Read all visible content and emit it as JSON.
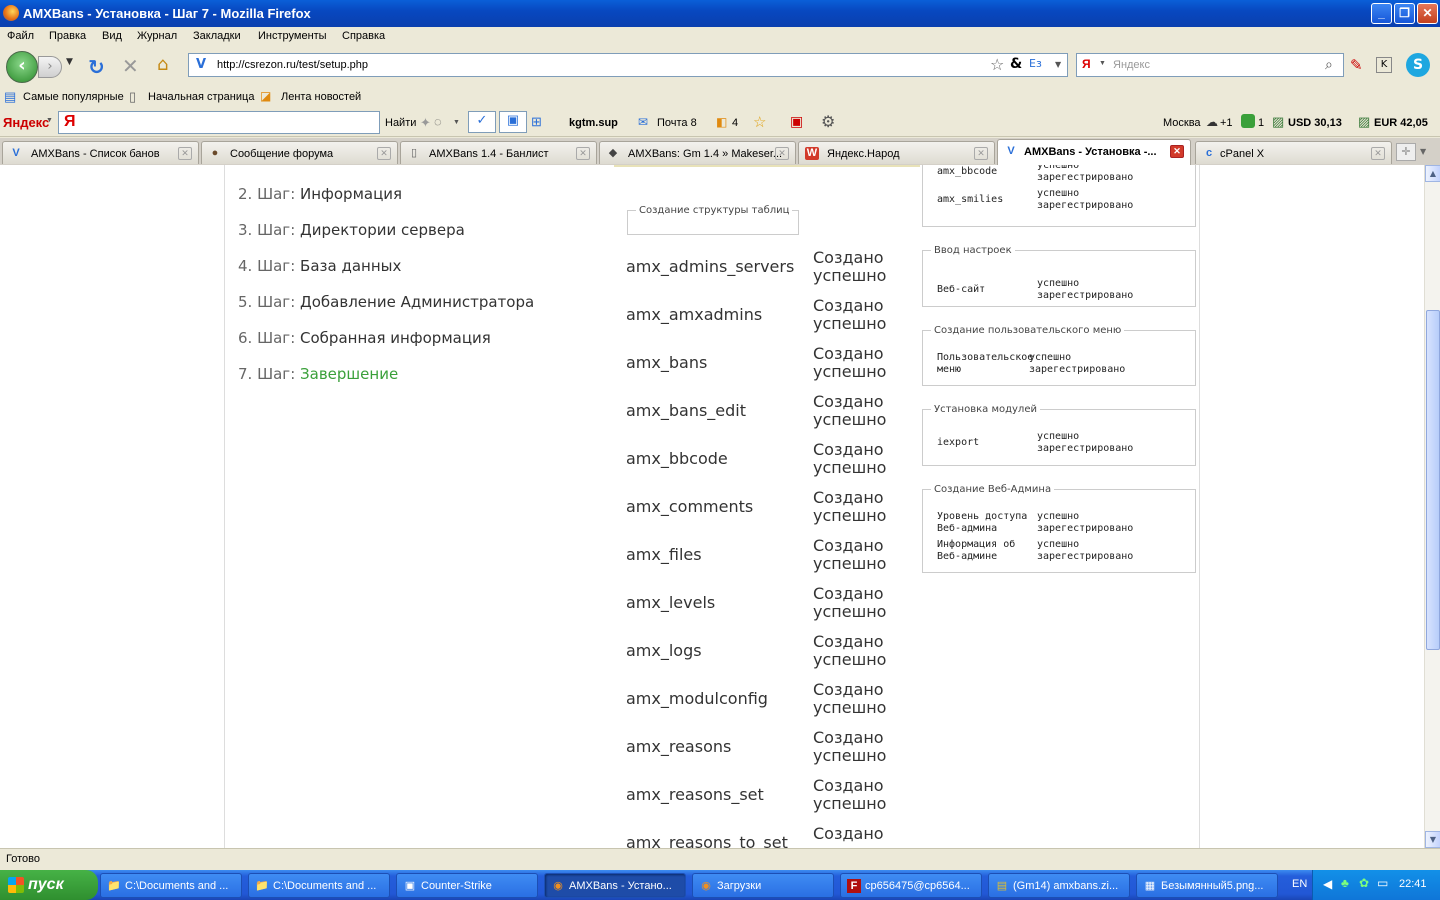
{
  "window": {
    "title": "AMXBans - Установка - Шаг 7 - Mozilla Firefox",
    "minimize": "_",
    "restore": "❐",
    "close": "✕"
  },
  "menu": [
    "Файл",
    "Правка",
    "Вид",
    "Журнал",
    "Закладки",
    "Инструменты",
    "Справка"
  ],
  "nav": {
    "url": "http://csrezon.ru/test/setup.php",
    "search_placeholder": "Яндекс"
  },
  "bookmarks": [
    "Самые популярные",
    "Начальная страница",
    "Лента новостей"
  ],
  "yandex_bar": {
    "brand": "Яндекс",
    "find": "Найти",
    "user": "kgtm.sup",
    "mail": "Почта 8",
    "count": "4",
    "city": "Москва",
    "temp": "+1",
    "traffic": "1",
    "usd": "USD 30,13",
    "eur": "EUR 42,05"
  },
  "tabs": [
    {
      "label": "AMXBans - Список банов",
      "icon": "V",
      "active": false
    },
    {
      "label": "Сообщение форума",
      "icon": "●",
      "active": false
    },
    {
      "label": "AMXBans 1.4 - Банлист",
      "icon": "▯",
      "active": false
    },
    {
      "label": "AMXBans: Gm 1.4 » Makeser...",
      "icon": "◆",
      "active": false
    },
    {
      "label": "Яндекс.Народ",
      "icon": "W",
      "active": false
    },
    {
      "label": "AMXBans - Установка -...",
      "icon": "V",
      "active": true
    },
    {
      "label": "cPanel X",
      "icon": "c",
      "active": false
    }
  ],
  "steps": [
    {
      "num": "2. Шаг:",
      "label": "Информация",
      "current": false
    },
    {
      "num": "3. Шаг:",
      "label": "Директории сервера",
      "current": false
    },
    {
      "num": "4. Шаг:",
      "label": "База данных",
      "current": false
    },
    {
      "num": "5. Шаг:",
      "label": "Добавление Администратора",
      "current": false
    },
    {
      "num": "6. Шаг:",
      "label": "Собранная информация",
      "current": false
    },
    {
      "num": "7. Шаг:",
      "label": "Завершение",
      "current": true
    }
  ],
  "table_section": {
    "legend": "Создание структуры таблиц",
    "rows": [
      {
        "name": "amx_admins_servers",
        "status": "Создано успешно"
      },
      {
        "name": "amx_amxadmins",
        "status": "Создано успешно"
      },
      {
        "name": "amx_bans",
        "status": "Создано успешно"
      },
      {
        "name": "amx_bans_edit",
        "status": "Создано успешно"
      },
      {
        "name": "amx_bbcode",
        "status": "Создано успешно"
      },
      {
        "name": "amx_comments",
        "status": "Создано успешно"
      },
      {
        "name": "amx_files",
        "status": "Создано успешно"
      },
      {
        "name": "amx_levels",
        "status": "Создано успешно"
      },
      {
        "name": "amx_logs",
        "status": "Создано успешно"
      },
      {
        "name": "amx_modulconfig",
        "status": "Создано успешно"
      },
      {
        "name": "amx_reasons",
        "status": "Создано успешно"
      },
      {
        "name": "amx_reasons_set",
        "status": "Создано успешно"
      },
      {
        "name": "amx_reasons_to_set",
        "status": "Создано"
      }
    ]
  },
  "right_panels": {
    "top": {
      "rows": [
        {
          "key": "amx_bbcode",
          "val": "успешно зарегестрировано"
        },
        {
          "key": "amx_smilies",
          "val": "успешно зарегестрировано"
        }
      ]
    },
    "settings": {
      "legend": "Ввод настроек",
      "rows": [
        {
          "key": "Веб-сайт",
          "val": "успешно зарегестрировано"
        }
      ]
    },
    "usermenu": {
      "legend": "Создание пользовательского меню",
      "rows": [
        {
          "key": "Пользовательское меню",
          "val": "успешно зарегестрировано"
        }
      ]
    },
    "modules": {
      "legend": "Установка модулей",
      "rows": [
        {
          "key": "iexport",
          "val": "успешно зарегестрировано"
        }
      ]
    },
    "webadmin": {
      "legend": "Создание Веб-Админа",
      "rows": [
        {
          "key": "Уровень доступа Веб-админа",
          "val": "успешно зарегестрировано"
        },
        {
          "key": "Информация об Веб-админе",
          "val": "успешно зарегестрировано"
        }
      ]
    }
  },
  "status": "Готово",
  "taskbar": {
    "start": "пуск",
    "items": [
      {
        "label": "C:\\Documents and ...",
        "icon": "📁",
        "active": false
      },
      {
        "label": "C:\\Documents and ...",
        "icon": "📁",
        "active": false
      },
      {
        "label": "Counter-Strike",
        "icon": "▣",
        "active": false
      },
      {
        "label": "AMXBans - Устано...",
        "icon": "◉",
        "active": true
      },
      {
        "label": "Загрузки",
        "icon": "◉",
        "active": false
      },
      {
        "label": "cp656475@cp6564...",
        "icon": "F",
        "active": false
      },
      {
        "label": "(Gm14) amxbans.zi...",
        "icon": "▤",
        "active": false
      },
      {
        "label": "Безымянный5.png...",
        "icon": "▦",
        "active": false
      }
    ],
    "lang": "EN",
    "clock": "22:41"
  },
  "colors": {
    "accent_green": "#3aa03a",
    "xp_blue": "#245edb"
  }
}
